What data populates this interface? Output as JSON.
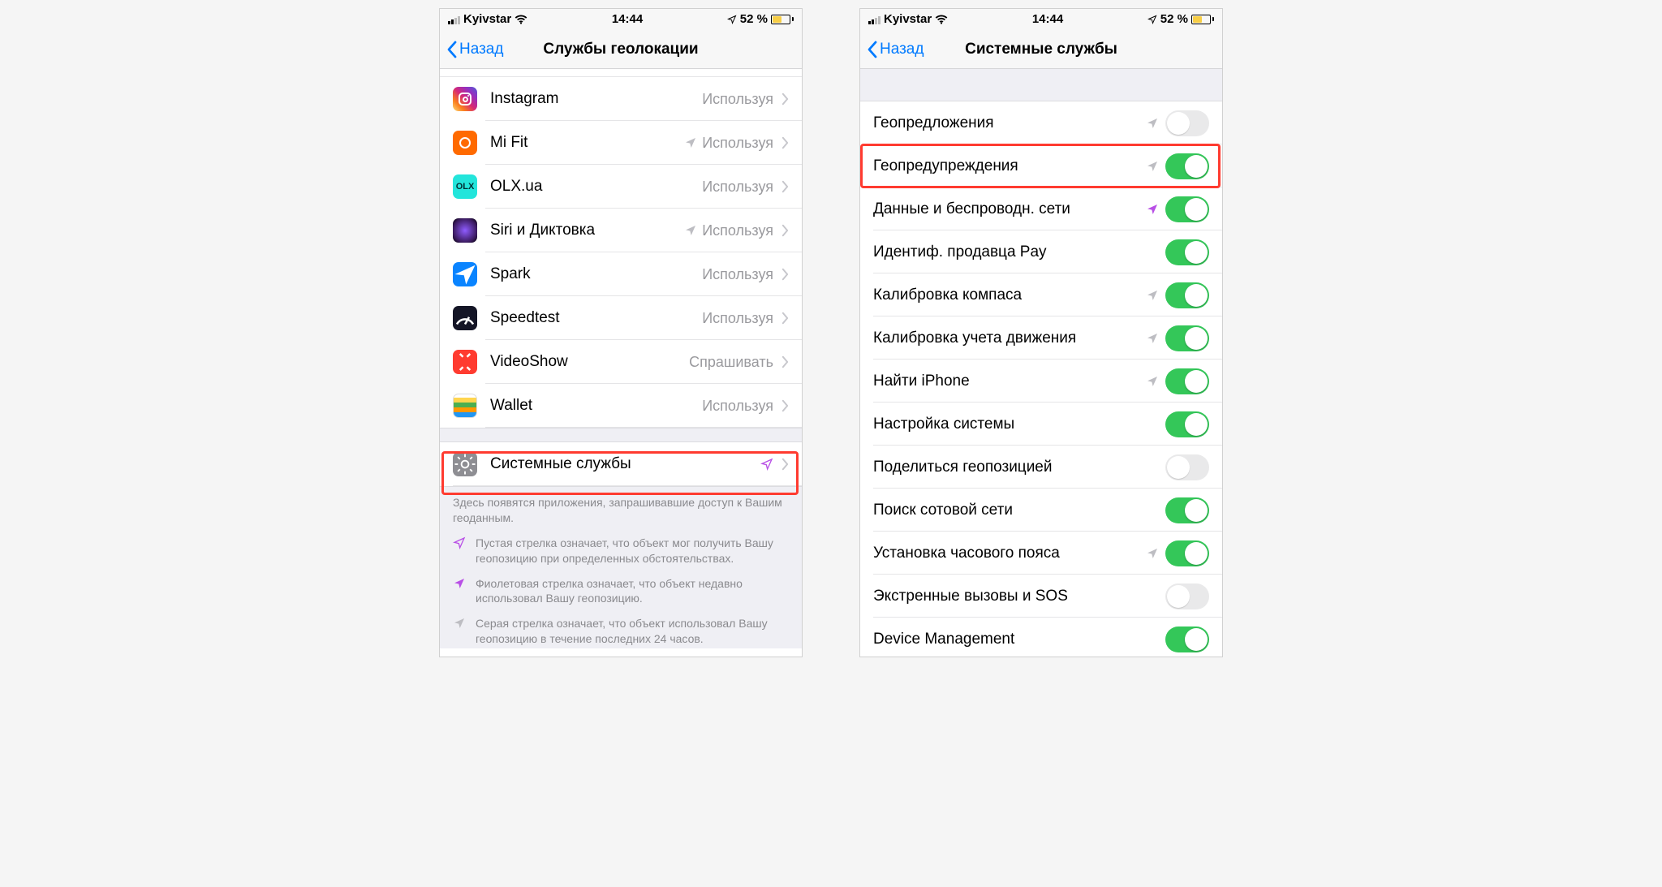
{
  "status": {
    "carrier": "Kyivstar",
    "time": "14:44",
    "battery_pct": "52 %"
  },
  "left": {
    "back_label": "Назад",
    "title": "Службы геолокации",
    "apps": [
      {
        "name": "Instagram",
        "status": "Используя",
        "arrow": null,
        "icon": "instagram"
      },
      {
        "name": "Mi Fit",
        "status": "Используя",
        "arrow": "gray",
        "icon": "mifit"
      },
      {
        "name": "OLX.ua",
        "status": "Используя",
        "arrow": null,
        "icon": "olx"
      },
      {
        "name": "Siri и Диктовка",
        "status": "Используя",
        "arrow": "gray",
        "icon": "siri"
      },
      {
        "name": "Spark",
        "status": "Используя",
        "arrow": null,
        "icon": "spark"
      },
      {
        "name": "Speedtest",
        "status": "Используя",
        "arrow": null,
        "icon": "speedtest"
      },
      {
        "name": "VideoShow",
        "status": "Спрашивать",
        "arrow": null,
        "icon": "videoshow"
      },
      {
        "name": "Wallet",
        "status": "Используя",
        "arrow": null,
        "icon": "wallet"
      }
    ],
    "system_row": {
      "name": "Системные службы",
      "arrow": "purple-outline"
    },
    "footer_lead": "Здесь появятся приложения, запрашивавшие доступ к Вашим геоданным.",
    "footer_items": [
      {
        "arrow": "purple-outline",
        "text": "Пустая стрелка означает, что объект мог получить Вашу геопозицию при определенных обстоятельствах."
      },
      {
        "arrow": "purple",
        "text": "Фиолетовая стрелка означает, что объект недавно использовал Вашу геопозицию."
      },
      {
        "arrow": "gray",
        "text": "Серая стрелка означает, что объект использовал Вашу геопозицию в течение последних 24 часов."
      }
    ]
  },
  "right": {
    "back_label": "Назад",
    "title": "Системные службы",
    "rows": [
      {
        "name": "Геопредложения",
        "arrow": "gray",
        "toggle": false
      },
      {
        "name": "Геопредупреждения",
        "arrow": "gray",
        "toggle": true,
        "highlight": true
      },
      {
        "name": "Данные и беспроводн. сети",
        "arrow": "purple",
        "toggle": true
      },
      {
        "name": "Идентиф. продавца Pay",
        "arrow": null,
        "toggle": true
      },
      {
        "name": "Калибровка компаса",
        "arrow": "gray",
        "toggle": true
      },
      {
        "name": "Калибровка учета движения",
        "arrow": "gray",
        "toggle": true
      },
      {
        "name": "Найти iPhone",
        "arrow": "gray",
        "toggle": true
      },
      {
        "name": "Настройка системы",
        "arrow": null,
        "toggle": true
      },
      {
        "name": "Поделиться геопозицией",
        "arrow": null,
        "toggle": false
      },
      {
        "name": "Поиск сотовой сети",
        "arrow": null,
        "toggle": true
      },
      {
        "name": "Установка часового пояса",
        "arrow": "gray",
        "toggle": true
      },
      {
        "name": "Экстренные вызовы и SOS",
        "arrow": null,
        "toggle": false
      },
      {
        "name": "Device Management",
        "arrow": null,
        "toggle": true
      }
    ]
  },
  "colors": {
    "purple": "#b84fe6",
    "gray": "#bdbdc2",
    "green": "#34c759",
    "highlight": "#ff3b30"
  }
}
